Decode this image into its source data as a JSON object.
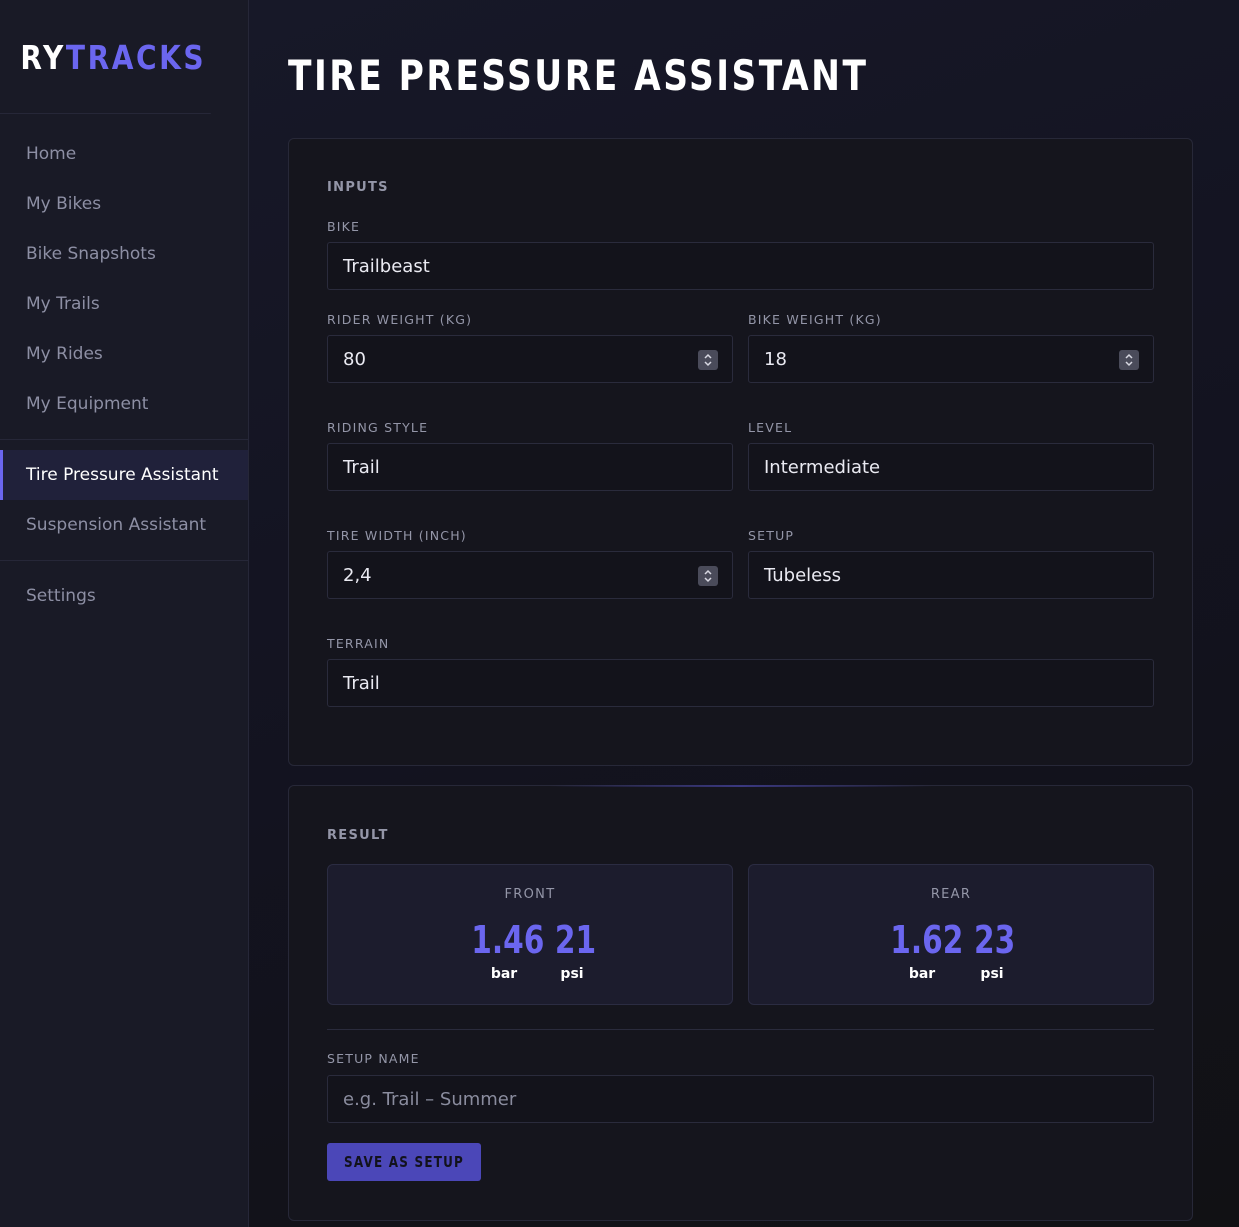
{
  "brand": {
    "part1": "RY",
    "part2": "TRACKS"
  },
  "sidebar": {
    "group1": [
      "Home",
      "My Bikes",
      "Bike Snapshots",
      "My Trails",
      "My Rides",
      "My Equipment"
    ],
    "group2": [
      "Tire Pressure Assistant",
      "Suspension Assistant"
    ],
    "group3": [
      "Settings"
    ],
    "active": "Tire Pressure Assistant"
  },
  "page": {
    "title": "TIRE PRESSURE ASSISTANT"
  },
  "inputs": {
    "section_label": "INPUTS",
    "bike": {
      "label": "BIKE",
      "value": "Trailbeast"
    },
    "rider_weight": {
      "label": "RIDER WEIGHT (KG)",
      "value": "80"
    },
    "bike_weight": {
      "label": "BIKE WEIGHT (KG)",
      "value": "18"
    },
    "riding_style": {
      "label": "RIDING STYLE",
      "value": "Trail"
    },
    "level": {
      "label": "LEVEL",
      "value": "Intermediate"
    },
    "tire_width": {
      "label": "TIRE WIDTH (INCH)",
      "value": "2,4"
    },
    "setup": {
      "label": "SETUP",
      "value": "Tubeless"
    },
    "terrain": {
      "label": "TERRAIN",
      "value": "Trail"
    }
  },
  "result": {
    "section_label": "RESULT",
    "front": {
      "label": "FRONT",
      "bar": "1.46",
      "psi": "21",
      "bar_unit": "bar",
      "psi_unit": "psi"
    },
    "rear": {
      "label": "REAR",
      "bar": "1.62",
      "psi": "23",
      "bar_unit": "bar",
      "psi_unit": "psi"
    },
    "setup_name": {
      "label": "SETUP NAME",
      "placeholder": "e.g. Trail – Summer",
      "value": ""
    },
    "save_label": "SAVE AS SETUP"
  },
  "colors": {
    "accent": "#6b66ef",
    "button": "#4b47b8",
    "sidebar_bg": "#191a26"
  },
  "icons": {
    "number_stepper": "chevron-up-down-icon"
  }
}
